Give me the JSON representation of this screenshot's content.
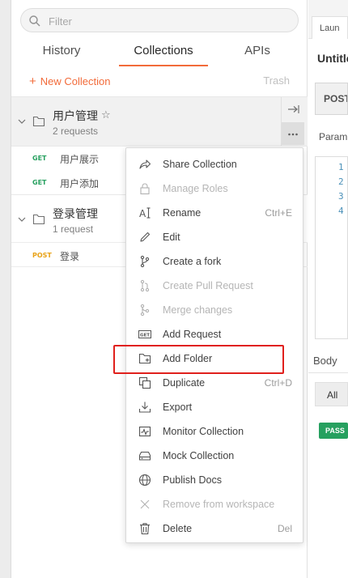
{
  "search": {
    "placeholder": "Filter"
  },
  "tabs": [
    {
      "label": "History"
    },
    {
      "label": "Collections"
    },
    {
      "label": "APIs"
    }
  ],
  "toolbar": {
    "new_collection": "New Collection",
    "trash": "Trash"
  },
  "collections": [
    {
      "name": "用户管理",
      "count": "2 requests",
      "requests": [
        {
          "method": "GET",
          "name": "用户展示"
        },
        {
          "method": "GET",
          "name": "用户添加"
        }
      ]
    },
    {
      "name": "登录管理",
      "count": "1 request",
      "requests": [
        {
          "method": "POST",
          "name": "登录"
        }
      ]
    }
  ],
  "context_menu": {
    "items": [
      {
        "label": "Share Collection",
        "icon": "share-icon",
        "shortcut": "",
        "enabled": true
      },
      {
        "label": "Manage Roles",
        "icon": "lock-icon",
        "shortcut": "",
        "enabled": false
      },
      {
        "label": "Rename",
        "icon": "text-cursor-icon",
        "shortcut": "Ctrl+E",
        "enabled": true
      },
      {
        "label": "Edit",
        "icon": "pencil-icon",
        "shortcut": "",
        "enabled": true
      },
      {
        "label": "Create a fork",
        "icon": "fork-icon",
        "shortcut": "",
        "enabled": true
      },
      {
        "label": "Create Pull Request",
        "icon": "pull-request-icon",
        "shortcut": "",
        "enabled": false
      },
      {
        "label": "Merge changes",
        "icon": "merge-icon",
        "shortcut": "",
        "enabled": false
      },
      {
        "label": "Add Request",
        "icon": "get-request-icon",
        "shortcut": "",
        "enabled": true
      },
      {
        "label": "Add Folder",
        "icon": "add-folder-icon",
        "shortcut": "",
        "enabled": true
      },
      {
        "label": "Duplicate",
        "icon": "duplicate-icon",
        "shortcut": "Ctrl+D",
        "enabled": true
      },
      {
        "label": "Export",
        "icon": "download-icon",
        "shortcut": "",
        "enabled": true
      },
      {
        "label": "Monitor Collection",
        "icon": "monitor-icon",
        "shortcut": "",
        "enabled": true
      },
      {
        "label": "Mock Collection",
        "icon": "server-icon",
        "shortcut": "",
        "enabled": true
      },
      {
        "label": "Publish Docs",
        "icon": "globe-icon",
        "shortcut": "",
        "enabled": true
      },
      {
        "label": "Remove from workspace",
        "icon": "close-icon",
        "shortcut": "",
        "enabled": false
      },
      {
        "label": "Delete",
        "icon": "trash-icon",
        "shortcut": "Del",
        "enabled": true
      }
    ]
  },
  "right_panel": {
    "tab": "Laun",
    "title": "Untitle",
    "method": "POST",
    "params": "Param",
    "line_numbers": [
      "1",
      "2",
      "3",
      "4"
    ],
    "body_label": "Body",
    "filter_all": "All",
    "status": "PASS"
  },
  "colors": {
    "accent": "#f26b3a",
    "get": "#26a05f",
    "post": "#e8a115",
    "highlight": "#e0201c"
  }
}
